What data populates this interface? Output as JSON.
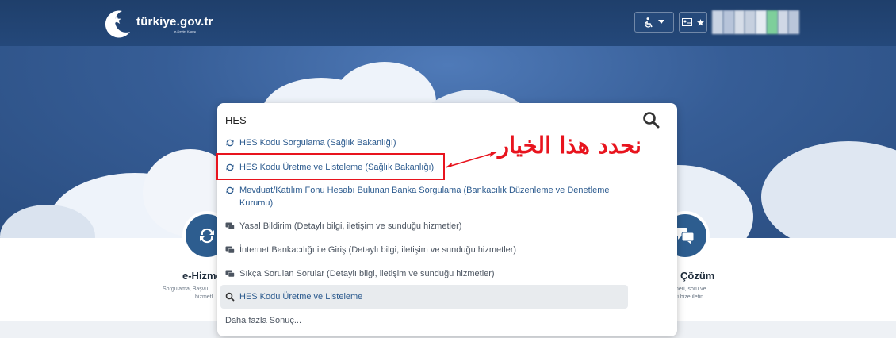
{
  "header": {
    "logo_text": "türkiye.gov.tr",
    "logo_tagline": "e-Devlet Kapısı",
    "accessibility_icon": "wheelchair-icon",
    "id_card_icon": "id-card-icon",
    "star_icon": "star-icon"
  },
  "search": {
    "value": "HES",
    "placeholder": ""
  },
  "results": [
    {
      "type": "service",
      "icon": "refresh-icon",
      "label": "HES Kodu Sorgulama (Sağlık Bakanlığı)"
    },
    {
      "type": "service",
      "icon": "refresh-icon",
      "label": "HES Kodu Üretme ve Listeleme (Sağlık Bakanlığı)"
    },
    {
      "type": "service",
      "icon": "refresh-icon",
      "label": "Mevduat/Katılım Fonu Hesabı Bulunan Banka Sorgulama (Bankacılık Düzenleme ve Denetleme Kurumu)"
    },
    {
      "type": "info",
      "icon": "chat-icon",
      "label": "Yasal Bildirim (Detaylı bilgi, iletişim ve sunduğu hizmetler)"
    },
    {
      "type": "info",
      "icon": "chat-icon",
      "label": "İnternet Bankacılığı ile Giriş (Detaylı bilgi, iletişim ve sunduğu hizmetler)"
    },
    {
      "type": "info",
      "icon": "chat-icon",
      "label": "Sıkça Sorulan Sorular (Detaylı bilgi, iletişim ve sunduğu hizmetler)"
    },
    {
      "type": "query",
      "icon": "search-icon",
      "label": "HES Kodu Üretme ve Listeleme"
    }
  ],
  "more_results": "Daha fazla Sonuç...",
  "annotation": {
    "text": "نحدد هذا الخيار",
    "color": "#e8141e"
  },
  "left_card": {
    "title": "e-Hizme",
    "desc_line1": "Sorgulama, Başvu",
    "desc_line2": "hizmetl"
  },
  "right_card": {
    "title": "Çözüm",
    "desc_line1": "neri, soru ve",
    "desc_line2": "ri bize iletin."
  },
  "colors": {
    "header_bg": "#1f3f6b",
    "link": "#2b5a8e",
    "accent_red": "#e8141e"
  }
}
